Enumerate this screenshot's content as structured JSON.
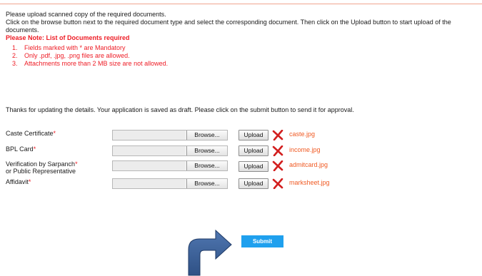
{
  "intro": {
    "line1": "Please upload scanned copy of the required documents.",
    "line2": "Click on the browse button next to the required document type and select the corresponding document. Then click on the Upload button to start upload of the documents.",
    "note": "Please Note: List of Documents required"
  },
  "rules": [
    {
      "num": "1.",
      "text": "Fields marked with * are Mandatory"
    },
    {
      "num": "2.",
      "text": "Only .pdf, .jpg, .png files are allowed."
    },
    {
      "num": "3.",
      "text": "Attachments more than 2 MB size are not allowed."
    }
  ],
  "thanks": "Thanks for updating the details. Your application is saved as draft. Please click on the submit button to send it for approval.",
  "documents": [
    {
      "label": "Caste Certificate",
      "label2": "",
      "required_mark": "*",
      "browse_label": "Browse...",
      "upload_label": "Upload",
      "file_name": "caste.jpg"
    },
    {
      "label": "BPL Card",
      "label2": "",
      "required_mark": "*",
      "browse_label": "Browse...",
      "upload_label": "Upload",
      "file_name": "income.jpg"
    },
    {
      "label": "Verification by Sarpanch",
      "label2": "or Public Representative",
      "required_mark": "*",
      "browse_label": "Browse...",
      "upload_label": "Upload",
      "file_name": "admitcard.jpg"
    },
    {
      "label": "Affidavit",
      "label2": "",
      "required_mark": "*",
      "browse_label": "Browse...",
      "upload_label": "Upload",
      "file_name": "marksheet.jpg"
    }
  ],
  "submit_label": "Submit",
  "colors": {
    "accent": "#1fa0ee",
    "required": "#ee1c25",
    "file_link": "#f05a23",
    "arrow": "#3b5f95",
    "delete_icon": "#d21f1f"
  },
  "icons": {
    "delete": "red-x-icon",
    "pointer": "curved-arrow-icon"
  }
}
